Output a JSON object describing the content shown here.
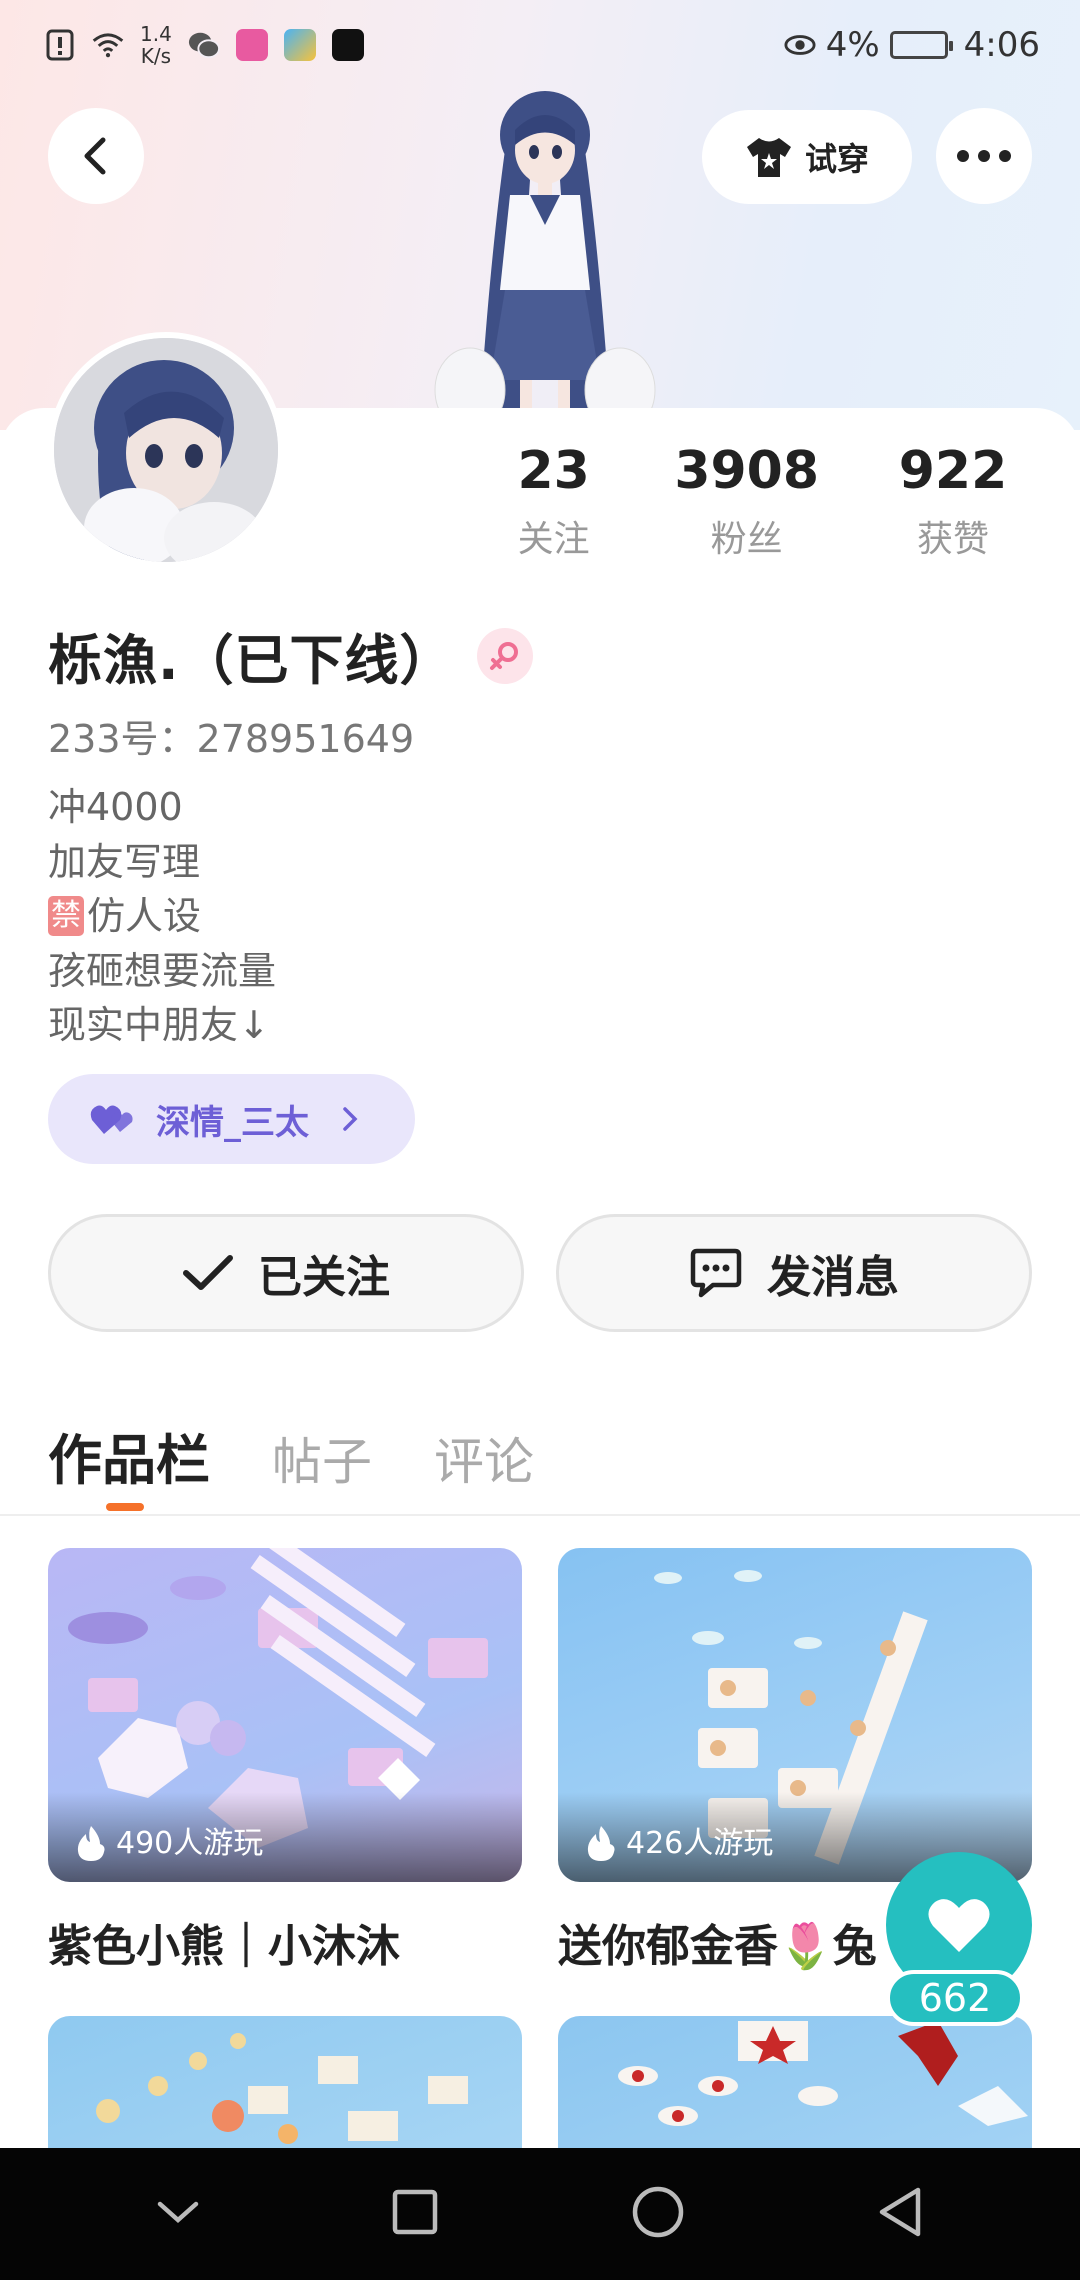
{
  "status_bar": {
    "net_speed_value": "1.4",
    "net_speed_unit": "K/s",
    "battery": "4%",
    "time": "4:06"
  },
  "header": {
    "tryon_label": "试穿"
  },
  "profile": {
    "stats": [
      {
        "value": "23",
        "label": "关注"
      },
      {
        "value": "3908",
        "label": "粉丝"
      },
      {
        "value": "922",
        "label": "获赞"
      }
    ],
    "nickname": "栎漁.（已下线）",
    "uid_line": "233号：278951649",
    "bio_lines": [
      "冲4000",
      "加友写理",
      "仿人设",
      "孩砸想要流量",
      "现实中朋友↓"
    ],
    "bio_ban_tag": "禁",
    "cp_tag": "深情_三太",
    "follow_button": "已关注",
    "message_button": "发消息"
  },
  "tabs": [
    "作品栏",
    "帖子",
    "评论"
  ],
  "works": [
    {
      "plays": "490人游玩",
      "title": "紫色小熊｜小沐沐"
    },
    {
      "plays": "426人游玩",
      "title": "送你郁金香🌷兔"
    }
  ],
  "like_fab": {
    "count": "662"
  },
  "colors": {
    "accent_orange": "#f5712a",
    "like_teal": "#25bfc0",
    "cp_purple": "#6d5fd6"
  }
}
